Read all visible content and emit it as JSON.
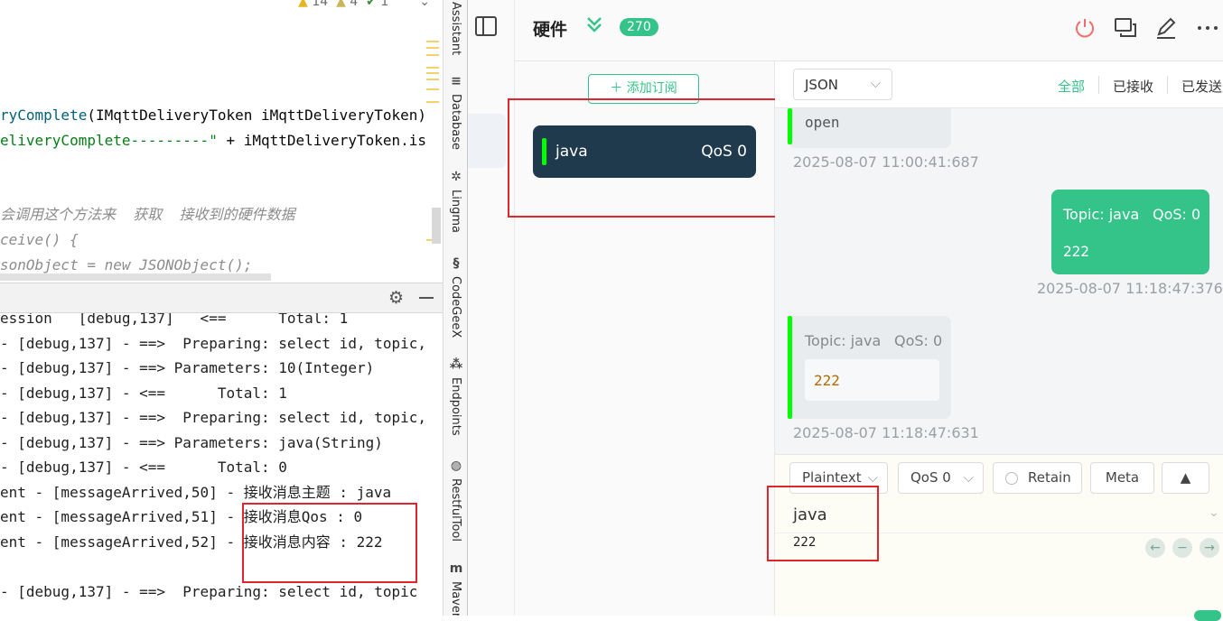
{
  "ide": {
    "inspection": {
      "warnings": "14",
      "weak_warnings": "4",
      "ok": "1"
    },
    "code_lines": [
      {
        "parts": [
          {
            "t": "ryComplete",
            "c": "c-method"
          },
          {
            "t": "(IMqttDeliveryToken iMqttDeliveryToken)",
            "c": "c-text"
          }
        ]
      },
      {
        "parts": [
          {
            "t": "eliveryComplete---------\"",
            "c": "c-str"
          },
          {
            "t": " + iMqttDeliveryToken.is",
            "c": "c-text"
          }
        ]
      },
      {
        "parts": [
          {
            "t": "会调用这个方法来  获取  接收到的硬件数据",
            "c": "c-comment"
          }
        ]
      },
      {
        "parts": [
          {
            "t": "ceive() {",
            "c": "c-comment"
          }
        ]
      },
      {
        "parts": [
          {
            "t": "sonObject = new JSONObject();",
            "c": "c-comment"
          }
        ]
      }
    ],
    "console_lines": [
      "ession   [debug,137]   <==      Total: 1",
      "- [debug,137] - ==>  Preparing: select id, topic,",
      "- [debug,137] - ==> Parameters: 10(Integer)",
      "- [debug,137] - <==      Total: 1",
      "- [debug,137] - ==>  Preparing: select id, topic,",
      "- [debug,137] - ==> Parameters: java(String)",
      "- [debug,137] - <==      Total: 0",
      "ent - [messageArrived,50] - 接收消息主题 : java",
      "ent - [messageArrived,51] - 接收消息Qos : 0",
      "ent - [messageArrived,52] - 接收消息内容 : 222",
      "",
      "- [debug,137] - ==>  Preparing: select id, topic"
    ],
    "tool_windows": [
      {
        "icon": "assistant-icon",
        "glyph": "",
        "label": "Assistant"
      },
      {
        "icon": "database-icon",
        "glyph": "≡",
        "label": "Database"
      },
      {
        "icon": "lingma-icon",
        "glyph": "✲",
        "label": "Lingma"
      },
      {
        "icon": "codegeex-icon",
        "glyph": "§",
        "label": "CodeGeeX"
      },
      {
        "icon": "endpoints-icon",
        "glyph": "⁂",
        "label": "Endpoints"
      },
      {
        "icon": "restfultool-icon",
        "glyph": "◍",
        "label": "RestfulTool"
      },
      {
        "icon": "maven-icon",
        "glyph": "m",
        "label": "Maven"
      }
    ]
  },
  "mqttx": {
    "connection": {
      "name": "硬件",
      "count": "270"
    },
    "header_icons": [
      "sidebar-toggle-icon",
      "power-icon",
      "chat-icon",
      "edit-icon",
      "more-icon"
    ],
    "subscriptions": {
      "add_label": "添加订阅",
      "items": [
        {
          "topic": "java",
          "qos": "QoS 0",
          "color": "#00ff00"
        }
      ]
    },
    "messages": {
      "format": "JSON",
      "filters": [
        "全部",
        "已接收",
        "已发送"
      ],
      "active_filter": "全部",
      "list": [
        {
          "direction": "received",
          "payload": "open",
          "time": "2025-08-07 11:00:41:687"
        },
        {
          "direction": "sent",
          "topic": "Topic: java",
          "qos": "QoS: 0",
          "payload": "222",
          "time": "2025-08-07 11:18:47:376"
        },
        {
          "direction": "received",
          "topic": "Topic: java",
          "qos": "QoS: 0",
          "payload": "222",
          "time": "2025-08-07 11:18:47:631"
        }
      ]
    },
    "publish": {
      "payload_format": "Plaintext",
      "qos": "QoS 0",
      "retain_label": "Retain",
      "meta_label": "Meta",
      "topic": "java",
      "payload": "222"
    },
    "colors": {
      "accent": "#34c388",
      "dark_card": "#1e3a4c",
      "highlight_box": "#e0262b"
    }
  }
}
